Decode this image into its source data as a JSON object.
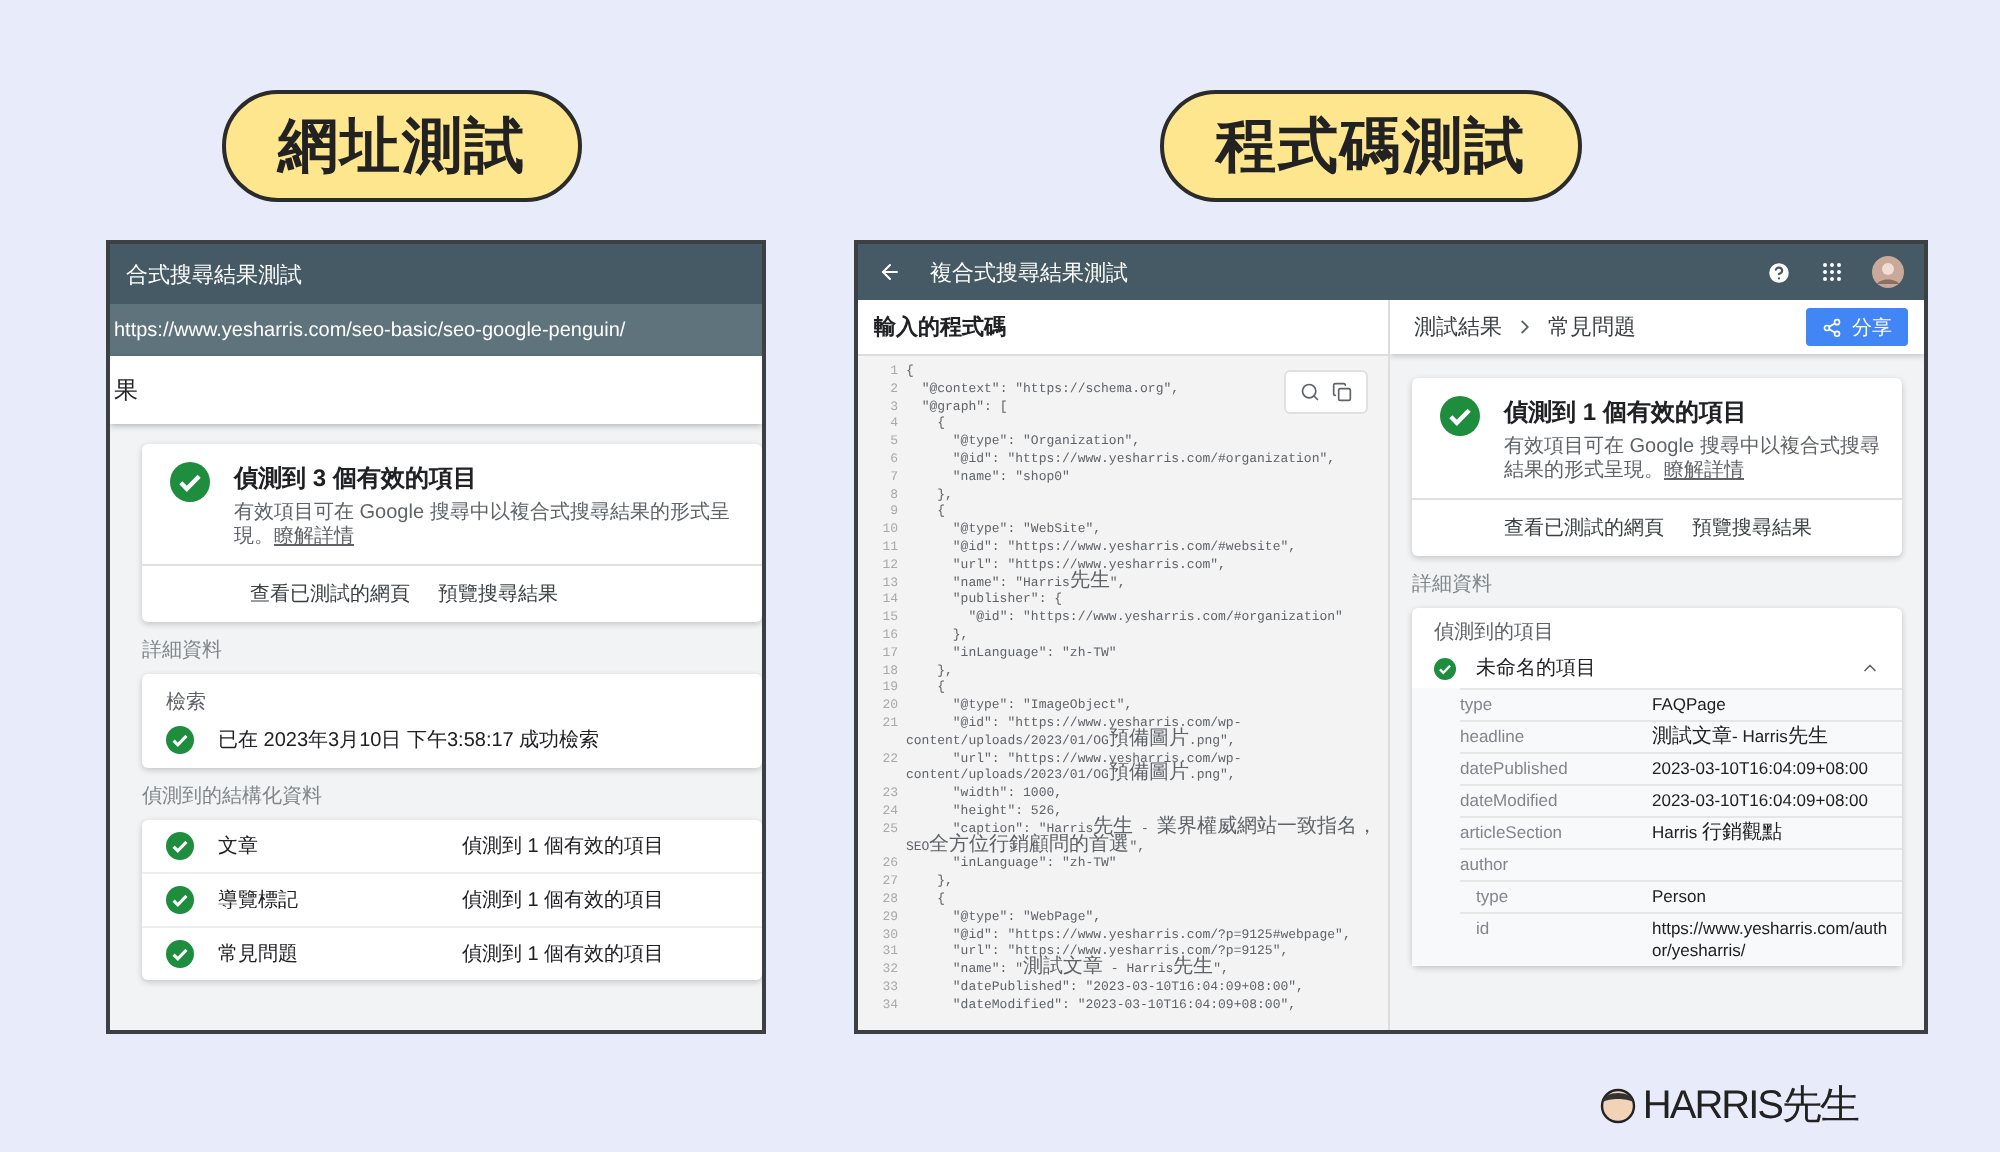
{
  "url_test": {
    "label": "網址測試",
    "title": "合式搜尋結果測試",
    "url": "https://www.yesharris.com/seo-basic/seo-google-penguin/",
    "heading": "果",
    "summary": {
      "headline": "偵測到 3 個有效的項目",
      "text": "有效項目可在 Google 搜尋中以複合式搜尋結果的形式呈現。",
      "link": "瞭解詳情",
      "actions": [
        "查看已測試的網頁",
        "預覽搜尋結果"
      ]
    },
    "details_label": "詳細資料",
    "crawl": {
      "label": "檢索",
      "status": "已在 2023年3月10日 下午3:58:17 成功檢索"
    },
    "structured_label": "偵測到的結構化資料",
    "structured": [
      {
        "name": "文章",
        "result": "偵測到 1 個有效的項目"
      },
      {
        "name": "導覽標記",
        "result": "偵測到 1 個有效的項目"
      },
      {
        "name": "常見問題",
        "result": "偵測到 1 個有效的項目"
      }
    ]
  },
  "code_test": {
    "label": "程式碼測試",
    "title": "複合式搜尋結果測試",
    "code_heading": "輸入的程式碼",
    "code": [
      {
        "n": "1",
        "code": "{"
      },
      {
        "n": "2",
        "code": "  \"@context\": \"https://schema.org\","
      },
      {
        "n": "3",
        "code": "  \"@graph\": ["
      },
      {
        "n": "4",
        "code": "    {"
      },
      {
        "n": "5",
        "code": "      \"@type\": \"Organization\","
      },
      {
        "n": "6",
        "code": "      \"@id\": \"https://www.yesharris.com/#organization\","
      },
      {
        "n": "7",
        "code": "      \"name\": \"shop0\""
      },
      {
        "n": "8",
        "code": "    },"
      },
      {
        "n": "9",
        "code": "    {"
      },
      {
        "n": "10",
        "code": "      \"@type\": \"WebSite\","
      },
      {
        "n": "11",
        "code": "      \"@id\": \"https://www.yesharris.com/#website\","
      },
      {
        "n": "12",
        "code": "      \"url\": \"https://www.yesharris.com\","
      },
      {
        "n": "13",
        "code": "      \"name\": \"Harris先生\","
      },
      {
        "n": "14",
        "code": "      \"publisher\": {"
      },
      {
        "n": "15",
        "code": "        \"@id\": \"https://www.yesharris.com/#organization\""
      },
      {
        "n": "16",
        "code": "      },"
      },
      {
        "n": "17",
        "code": "      \"inLanguage\": \"zh-TW\""
      },
      {
        "n": "18",
        "code": "    },"
      },
      {
        "n": "19",
        "code": "    {"
      },
      {
        "n": "20",
        "code": "      \"@type\": \"ImageObject\","
      },
      {
        "n": "21",
        "code": "      \"@id\": \"https://www.yesharris.com/wp-content/uploads/2023/01/OG預備圖片.png\","
      },
      {
        "n": "22",
        "code": "      \"url\": \"https://www.yesharris.com/wp-content/uploads/2023/01/OG預備圖片.png\","
      },
      {
        "n": "23",
        "code": "      \"width\": 1000,"
      },
      {
        "n": "24",
        "code": "      \"height\": 526,"
      },
      {
        "n": "25",
        "code": "      \"caption\": \"Harris先生 - 業界權威網站一致指名，SEO全方位行銷顧問的首選\","
      },
      {
        "n": "26",
        "code": "      \"inLanguage\": \"zh-TW\""
      },
      {
        "n": "27",
        "code": "    },"
      },
      {
        "n": "28",
        "code": "    {"
      },
      {
        "n": "29",
        "code": "      \"@type\": \"WebPage\","
      },
      {
        "n": "30",
        "code": "      \"@id\": \"https://www.yesharris.com/?p=9125#webpage\","
      },
      {
        "n": "31",
        "code": "      \"url\": \"https://www.yesharris.com/?p=9125\","
      },
      {
        "n": "32",
        "code": "      \"name\": \"測試文章 - Harris先生\","
      },
      {
        "n": "33",
        "code": "      \"datePublished\": \"2023-03-10T16:04:09+08:00\","
      },
      {
        "n": "34",
        "code": "      \"dateModified\": \"2023-03-10T16:04:09+08:00\","
      }
    ],
    "breadcrumb": [
      "測試結果",
      "常見問題"
    ],
    "share": "分享",
    "summary": {
      "headline": "偵測到 1 個有效的項目",
      "text": "有效項目可在 Google 搜尋中以複合式搜尋結果的形式呈現。",
      "link": "瞭解詳情",
      "actions": [
        "查看已測試的網頁",
        "預覽搜尋結果"
      ]
    },
    "details_label": "詳細資料",
    "items_label": "偵測到的項目",
    "item": {
      "name": "未命名的項目",
      "expanded": true,
      "properties": [
        {
          "key": "type",
          "value": "FAQPage"
        },
        {
          "key": "headline",
          "value": "測試文章- Harris先生"
        },
        {
          "key": "datePublished",
          "value": "2023-03-10T16:04:09+08:00"
        },
        {
          "key": "dateModified",
          "value": "2023-03-10T16:04:09+08:00"
        },
        {
          "key": "articleSection",
          "value": "Harris 行銷觀點"
        },
        {
          "key": "author",
          "children": [
            {
              "key": "type",
              "value": "Person"
            },
            {
              "key": "id",
              "value": "https://www.yesharris.com/author/yesharris/"
            }
          ]
        }
      ]
    }
  },
  "logo": "HARRIS先生"
}
